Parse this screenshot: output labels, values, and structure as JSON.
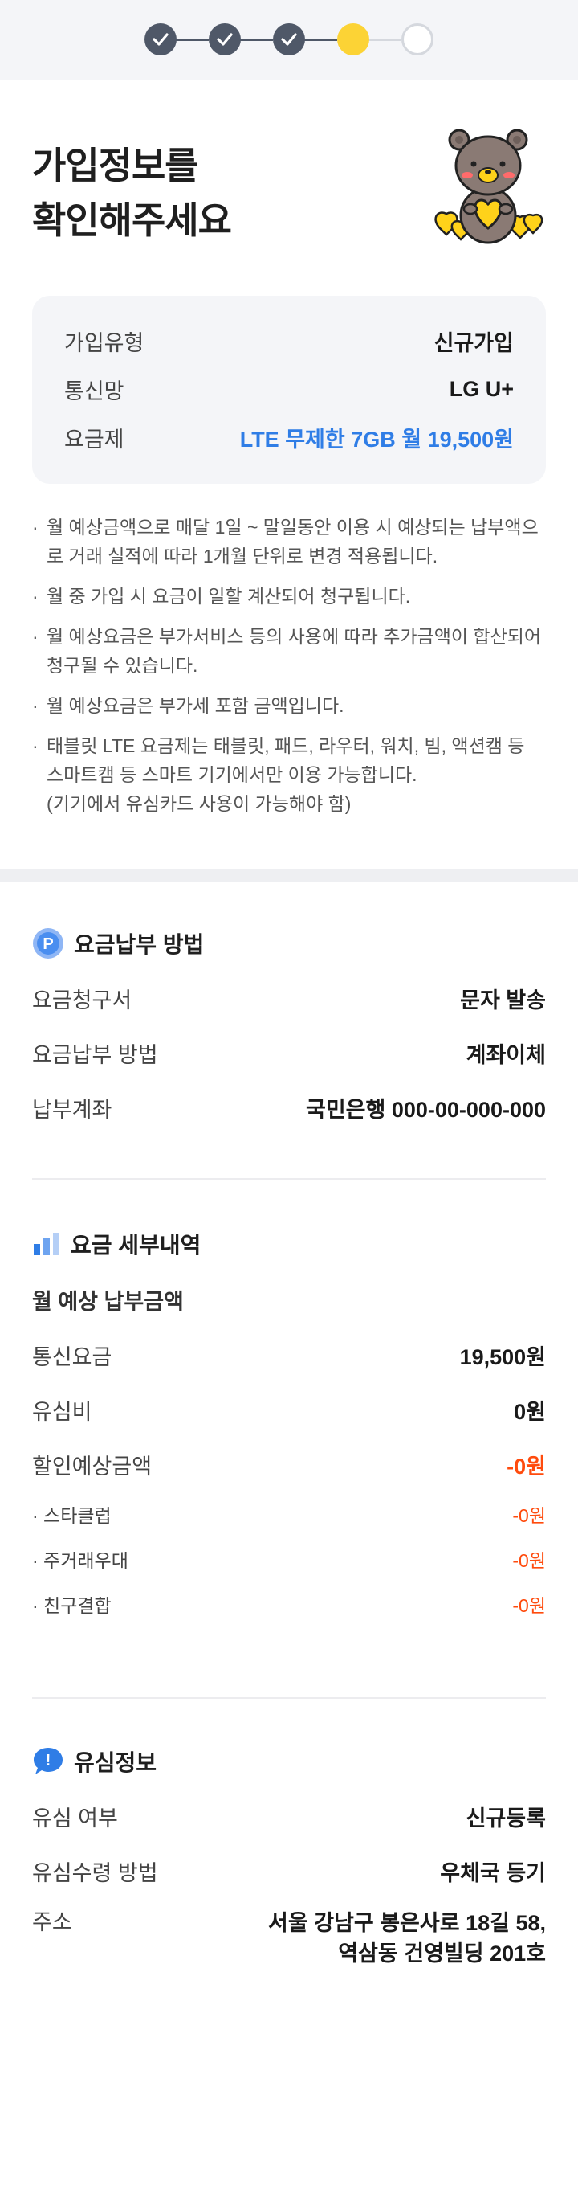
{
  "progress": {
    "current_step": 4,
    "total_steps": 5
  },
  "header": {
    "title_line1": "가입정보를",
    "title_line2": "확인해주세요",
    "mascot_icon": "bear-holding-hearts-icon"
  },
  "summary": {
    "rows": [
      {
        "label": "가입유형",
        "value": "신규가입"
      },
      {
        "label": "통신망",
        "value": "LG U+"
      },
      {
        "label": "요금제",
        "value": "LTE 무제한 7GB  월 19,500원"
      }
    ]
  },
  "notes": [
    "월 예상금액으로 매달 1일 ~ 말일동안 이용 시 예상되는 납부액으로 거래 실적에 따라 1개월 단위로 변경 적용됩니다.",
    "월 중 가입 시 요금이 일할 계산되어 청구됩니다.",
    "월 예상요금은 부가서비스 등의 사용에 따라 추가금액이 합산되어 청구될 수 있습니다.",
    "월 예상요금은 부가세 포함 금액입니다.",
    "태블릿 LTE 요금제는 태블릿, 패드, 라우터, 워치, 빔, 액션캠 등 스마트캠 등 스마트 기기에서만 이용 가능합니다.",
    "(기기에서 유심카드 사용이 가능해야 함)"
  ],
  "payment": {
    "title": "요금납부 방법",
    "icon_letter": "P",
    "rows": [
      {
        "label": "요금청구서",
        "value": "문자 발송"
      },
      {
        "label": "요금납부 방법",
        "value": "계좌이체"
      },
      {
        "label": "납부계좌",
        "value": "국민은행 000-00-000-000"
      }
    ]
  },
  "details": {
    "title": "요금 세부내역",
    "subtitle": "월 예상 납부금액",
    "rows": [
      {
        "label": "통신요금",
        "value": "19,500원"
      },
      {
        "label": "유심비",
        "value": "0원"
      },
      {
        "label": "할인예상금액",
        "value": "-0원"
      }
    ],
    "discounts": [
      {
        "label": "· 스타클럽",
        "value": "-0원"
      },
      {
        "label": "· 주거래우대",
        "value": "-0원"
      },
      {
        "label": "· 친구결합",
        "value": "-0원"
      }
    ]
  },
  "usim": {
    "title": "유심정보",
    "icon_mark": "!",
    "rows": [
      {
        "label": "유심 여부",
        "value": "신규등록"
      },
      {
        "label": "유심수령 방법",
        "value": "우체국 등기"
      }
    ],
    "address": {
      "label": "주소",
      "line1": "서울 강남구 봉은사로 18길 58,",
      "line2": "역삼동 건영빌딩 201호"
    }
  },
  "colors": {
    "accent_blue": "#2f7de6",
    "discount_red": "#ff4b0d",
    "step_done": "#4f5868",
    "step_current": "#fcd335"
  }
}
